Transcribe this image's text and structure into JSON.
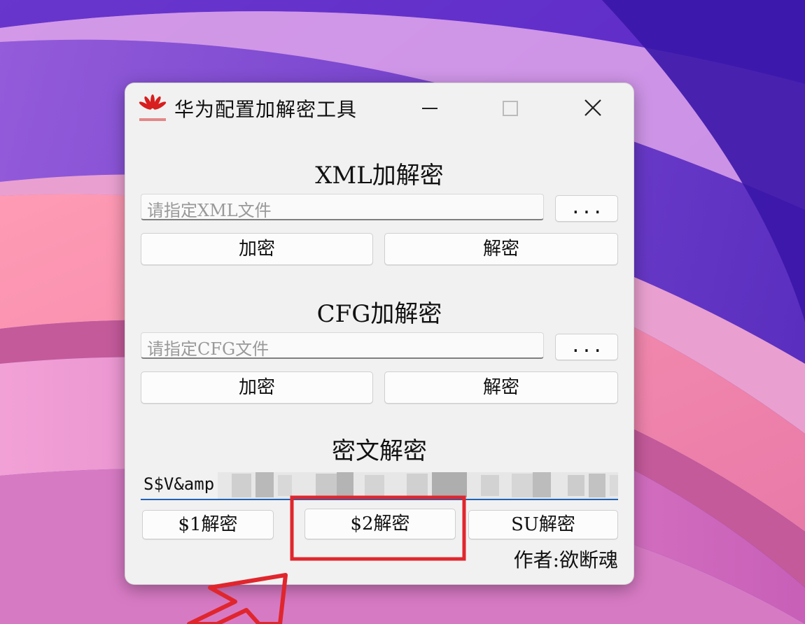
{
  "window": {
    "title": "华为配置加解密工具",
    "controls": [
      "minimize",
      "maximize",
      "close"
    ]
  },
  "xml": {
    "title": "XML加解密",
    "placeholder": "请指定XML文件",
    "browse_label": "...",
    "encrypt_label": "加密",
    "decrypt_label": "解密"
  },
  "cfg": {
    "title": "CFG加解密",
    "placeholder": "请指定CFG文件",
    "browse_label": "...",
    "encrypt_label": "加密",
    "decrypt_label": "解密"
  },
  "cipher": {
    "title": "密文解密",
    "value_visible": "S$V&amp",
    "btn1_label": "$1解密",
    "btn2_label": "$2解密",
    "su_label": "SU解密"
  },
  "author": "作者:欲断魂",
  "colors": {
    "highlight_box": "#e0262d",
    "arrow": "#e0262d",
    "input_focus": "#1f63b6"
  },
  "icons": {
    "logo": "huawei-logo-icon",
    "minimize": "minimize-icon",
    "maximize": "maximize-icon",
    "close": "close-icon"
  }
}
